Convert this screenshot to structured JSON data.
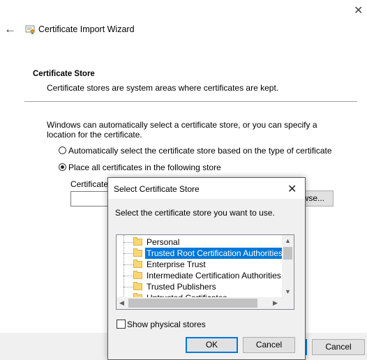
{
  "window": {
    "title": "Certificate Import Wizard",
    "icons": {
      "back": "back-arrow-icon",
      "app": "certificate-icon",
      "close": "close-icon"
    }
  },
  "store_page": {
    "heading": "Certificate Store",
    "subheading": "Certificate stores are system areas where certificates are kept.",
    "intro": "Windows can automatically select a certificate store, or you can specify a location for the certificate.",
    "option_auto": "Automatically select the certificate store based on the type of certificate",
    "option_manual": "Place all certificates in the following store",
    "store_label": "Certificate",
    "store_value": "",
    "browse_label": "wse...",
    "selected_option": "manual"
  },
  "footer": {
    "cancel_label": "Cancel"
  },
  "dialog": {
    "title": "Select Certificate Store",
    "prompt": "Select the certificate store you want to use.",
    "stores": [
      "Personal",
      "Trusted Root Certification Authorities",
      "Enterprise Trust",
      "Intermediate Certification Authorities",
      "Trusted Publishers",
      "Untrusted Certificates"
    ],
    "selected_store": "Trusted Root Certification Authorities",
    "show_physical_label": "Show physical stores",
    "show_physical_checked": false,
    "ok_label": "OK",
    "cancel_label": "Cancel"
  },
  "colors": {
    "accent": "#0078d7",
    "footer_bg": "#f0f0f0",
    "folder": "#f8d775"
  }
}
